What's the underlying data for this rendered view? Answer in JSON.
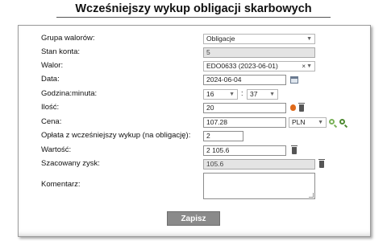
{
  "page": {
    "title": "Wcześniejszy wykup obligacji skarbowych"
  },
  "form": {
    "group_label": "Grupa walorów:",
    "group_value": "Obligacje",
    "balance_label": "Stan konta:",
    "balance_value": "5",
    "asset_label": "Walor:",
    "asset_value": "EDO0633 (2023-06-01)",
    "date_label": "Data:",
    "date_value": "2024-06-04",
    "time_label": "Godzina:minuta:",
    "hour_value": "16",
    "minute_value": "37",
    "quantity_label": "Ilość:",
    "quantity_value": "20",
    "price_label": "Cena:",
    "price_value": "107.28",
    "currency_value": "PLN",
    "fee_label": "Opłata z wcześniejszy wykup (na obligację):",
    "fee_value": "2",
    "value_label": "Wartość:",
    "value_value": "2 105.6",
    "profit_label": "Szacowany zysk:",
    "profit_value": "105.6",
    "comment_label": "Komentarz:",
    "comment_value": "",
    "submit_label": "Zapisz"
  },
  "icons": {
    "calendar": "calendar-icon",
    "trash": "trash-icon",
    "fire": "fire-icon",
    "search": "magnifier-icon"
  }
}
